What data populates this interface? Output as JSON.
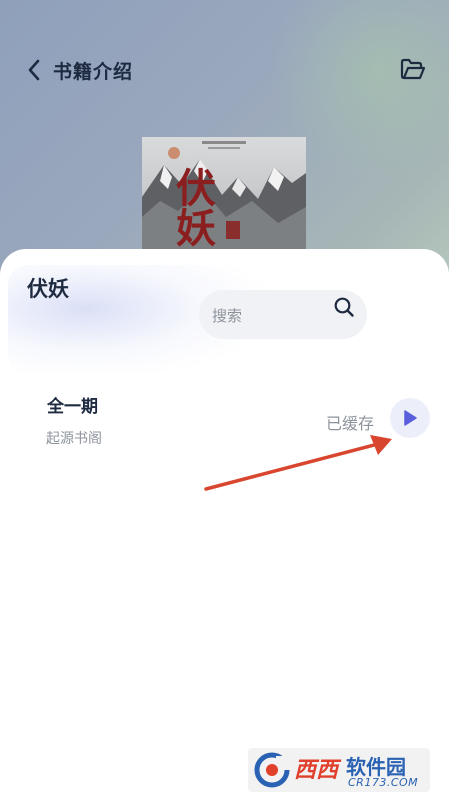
{
  "header": {
    "title": "书籍介绍",
    "back_icon": "back-chevron-icon",
    "folder_icon": "folder-open-icon"
  },
  "cover": {
    "title": "伏妖"
  },
  "book": {
    "name": "伏妖"
  },
  "search": {
    "placeholder": "搜索",
    "icon": "search-icon"
  },
  "episodes": [
    {
      "title": "全一期",
      "source": "起源书阁",
      "status": "已缓存",
      "action_icon": "play-icon"
    }
  ],
  "annotation": {
    "color": "#d9462f"
  },
  "watermark": {
    "brand": "西西",
    "name": "软件园",
    "domain": "CR173.COM"
  },
  "colors": {
    "accent": "#5a5fdb",
    "title_text": "#1e2a40",
    "muted_text": "#8d939c"
  }
}
